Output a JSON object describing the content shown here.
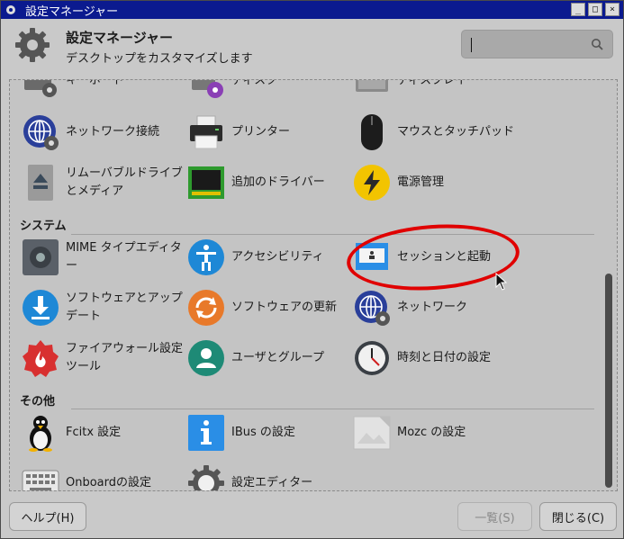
{
  "window": {
    "title": "設定マネージャー",
    "controls": [
      "_",
      "□",
      "×"
    ]
  },
  "header": {
    "title": "設定マネージャー",
    "subtitle": "デスクトップをカスタマイズします",
    "search_value": ""
  },
  "partial_row": {
    "items": [
      {
        "label": "キーボード",
        "icon": "keyboard-icon"
      },
      {
        "label": "ディスク",
        "icon": "disk-icon"
      },
      {
        "label": "ディスプレイ",
        "icon": "display-icon"
      }
    ]
  },
  "hardware": {
    "items": [
      {
        "label": "ネットワーク接続",
        "icon": "network-connections-icon"
      },
      {
        "label": "プリンター",
        "icon": "printer-icon"
      },
      {
        "label": "マウスとタッチパッド",
        "icon": "mouse-icon"
      },
      {
        "label": "リムーバブルドライブとメディア",
        "icon": "removable-drive-icon"
      },
      {
        "label": "追加のドライバー",
        "icon": "additional-drivers-icon"
      },
      {
        "label": "電源管理",
        "icon": "power-manager-icon"
      }
    ]
  },
  "system": {
    "heading": "システム",
    "items": [
      {
        "label": "MIME タイプエディター",
        "icon": "mime-editor-icon"
      },
      {
        "label": "アクセシビリティ",
        "icon": "accessibility-icon"
      },
      {
        "label": "セッションと起動",
        "icon": "session-startup-icon"
      },
      {
        "label": "ソフトウェアとアップデート",
        "icon": "software-updates-icon"
      },
      {
        "label": "ソフトウェアの更新",
        "icon": "software-updater-icon"
      },
      {
        "label": "ネットワーク",
        "icon": "network-icon"
      },
      {
        "label": "ファイアウォール設定ツール",
        "icon": "firewall-icon"
      },
      {
        "label": "ユーザとグループ",
        "icon": "users-groups-icon"
      },
      {
        "label": "時刻と日付の設定",
        "icon": "clock-icon"
      }
    ]
  },
  "other": {
    "heading": "その他",
    "items": [
      {
        "label": "Fcitx 設定",
        "icon": "fcitx-penguin-icon"
      },
      {
        "label": "IBus の設定",
        "icon": "ibus-info-icon"
      },
      {
        "label": "Mozc の設定",
        "icon": "mozc-icon"
      },
      {
        "label": "Onboardの設定",
        "icon": "onboard-keyboard-icon"
      },
      {
        "label": "設定エディター",
        "icon": "settings-editor-icon"
      }
    ]
  },
  "footer": {
    "help": "ヘルプ(H)",
    "all": "一覧(S)",
    "close": "閉じる(C)"
  },
  "colors": {
    "titlebar": "#0b1a8f",
    "annotation": "#e00000"
  }
}
